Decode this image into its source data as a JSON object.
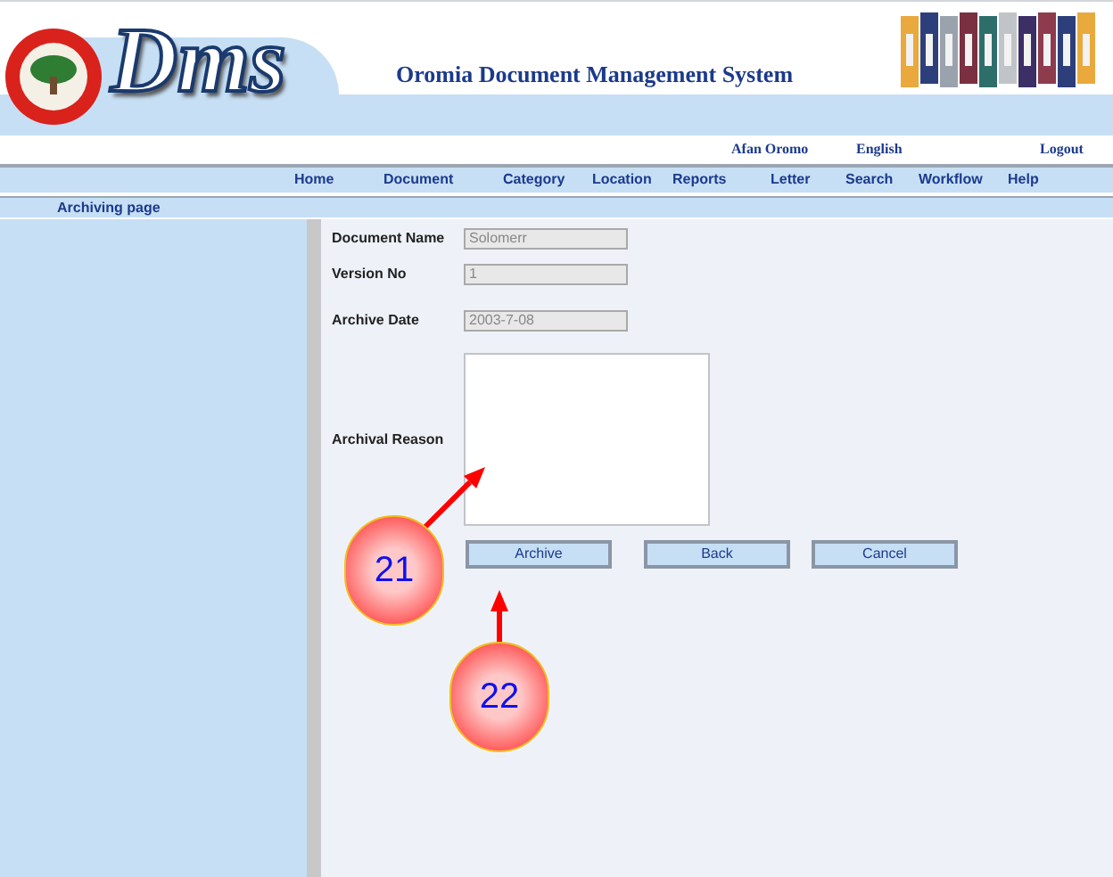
{
  "header": {
    "logo_text": "Dms",
    "title": "Oromia Document Management System"
  },
  "language_links": [
    {
      "label": "Afan Oromo"
    },
    {
      "label": "English"
    }
  ],
  "logout": "Logout",
  "nav": [
    {
      "label": "Home"
    },
    {
      "label": "Document"
    },
    {
      "label": "Category"
    },
    {
      "label": "Location"
    },
    {
      "label": "Reports"
    },
    {
      "label": "Letter"
    },
    {
      "label": "Search"
    },
    {
      "label": "Workflow"
    },
    {
      "label": "Help"
    }
  ],
  "breadcrumb": "Archiving page",
  "form": {
    "fields": [
      {
        "kind": "input",
        "label": "Document Name",
        "value": "Solomerr",
        "disabled": true
      },
      {
        "kind": "input",
        "label": "Version No",
        "value": "1",
        "disabled": true
      },
      {
        "kind": "input",
        "label": "Archive Date",
        "value": "2003-7-08",
        "disabled": true
      },
      {
        "kind": "textarea",
        "label": "Archival Reason"
      }
    ],
    "buttons": [
      {
        "label": "Archive"
      },
      {
        "label": "Back"
      },
      {
        "label": "Cancel"
      }
    ]
  },
  "callouts": [
    {
      "label": "21"
    },
    {
      "label": "22"
    }
  ]
}
